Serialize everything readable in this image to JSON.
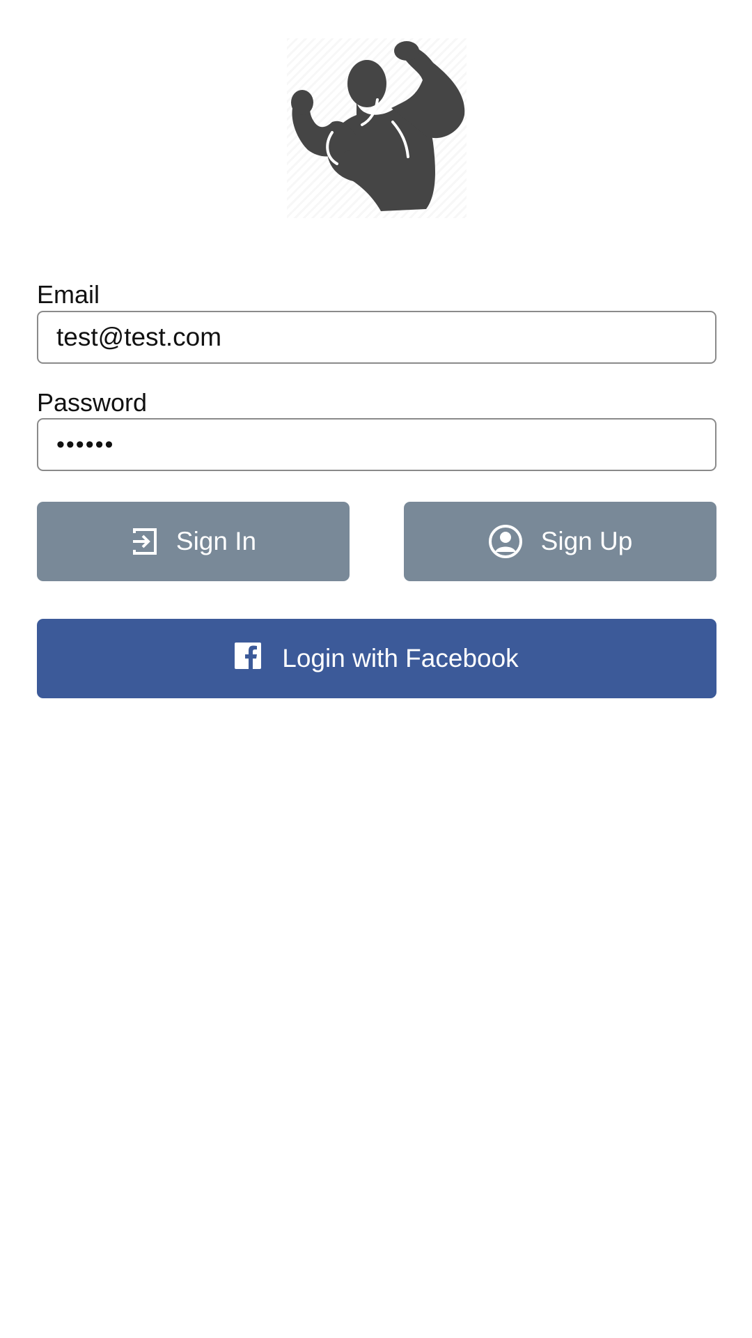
{
  "app": {
    "logo_icon": "bodybuilder-flexing-icon"
  },
  "form": {
    "email_label": "Email",
    "email_value": "test@test.com",
    "password_label": "Password",
    "password_value": "••••••"
  },
  "buttons": {
    "sign_in_label": "Sign In",
    "sign_in_icon": "sign-in-arrow-icon",
    "sign_up_label": "Sign Up",
    "sign_up_icon": "user-circle-icon",
    "facebook_label": "Login with Facebook",
    "facebook_icon": "facebook-icon"
  },
  "colors": {
    "secondary_button": "#798998",
    "facebook_button": "#3c5a99",
    "logo_fill": "#454545"
  }
}
